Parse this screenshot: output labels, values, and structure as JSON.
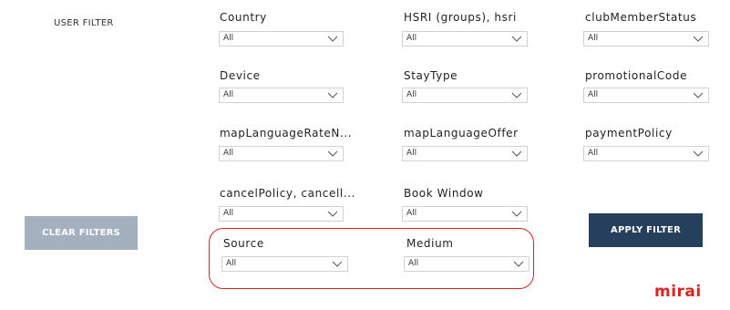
{
  "title": "USER FILTER",
  "filters": [
    {
      "label": "Country",
      "value": "All"
    },
    {
      "label": "HSRI (groups), hsri",
      "value": "All"
    },
    {
      "label": "clubMemberStatus",
      "value": "All"
    },
    {
      "label": "Device",
      "value": "All"
    },
    {
      "label": "StayType",
      "value": "All"
    },
    {
      "label": "promotionalCode",
      "value": "All"
    },
    {
      "label": "mapLanguageRateN...",
      "value": "All"
    },
    {
      "label": "mapLanguageOffer",
      "value": "All"
    },
    {
      "label": "paymentPolicy",
      "value": "All"
    },
    {
      "label": "cancelPolicy, cancell...",
      "value": "All"
    },
    {
      "label": "Book Window",
      "value": "All"
    },
    {
      "label": "Source",
      "value": "All"
    },
    {
      "label": "Medium",
      "value": "All"
    }
  ],
  "buttons": {
    "clear": "CLEAR FILTERS",
    "apply": "APPLY FILTER"
  },
  "logo": "mirai",
  "colors": {
    "apply_button": "#253f5d",
    "clear_button": "#a3b0bd",
    "highlight": "#d8231f",
    "logo": "#d8231f"
  }
}
